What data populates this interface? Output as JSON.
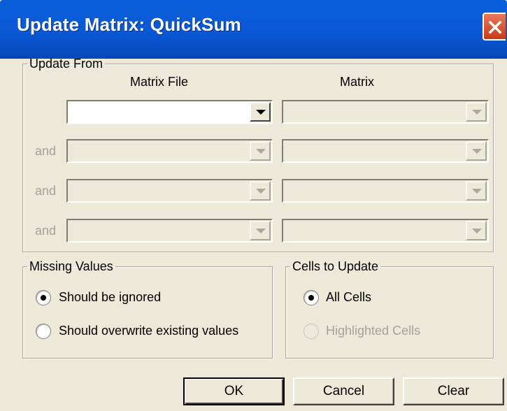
{
  "window": {
    "title": "Update Matrix: QuickSum"
  },
  "update_from": {
    "legend": "Update From",
    "col_matrix_file": "Matrix File",
    "col_matrix": "Matrix",
    "and_label": "and",
    "rows": [
      {
        "matrix_file": "",
        "matrix": ""
      },
      {
        "matrix_file": "",
        "matrix": ""
      },
      {
        "matrix_file": "",
        "matrix": ""
      },
      {
        "matrix_file": "",
        "matrix": ""
      }
    ]
  },
  "missing_values": {
    "legend": "Missing Values",
    "options": [
      {
        "label": "Should be ignored",
        "selected": true
      },
      {
        "label": "Should overwrite existing values",
        "selected": false
      }
    ]
  },
  "cells_to_update": {
    "legend": "Cells to Update",
    "options": [
      {
        "label": "All Cells",
        "selected": true,
        "enabled": true
      },
      {
        "label": "Highlighted Cells",
        "selected": false,
        "enabled": false
      }
    ]
  },
  "buttons": {
    "ok": "OK",
    "cancel": "Cancel",
    "clear": "Clear"
  }
}
